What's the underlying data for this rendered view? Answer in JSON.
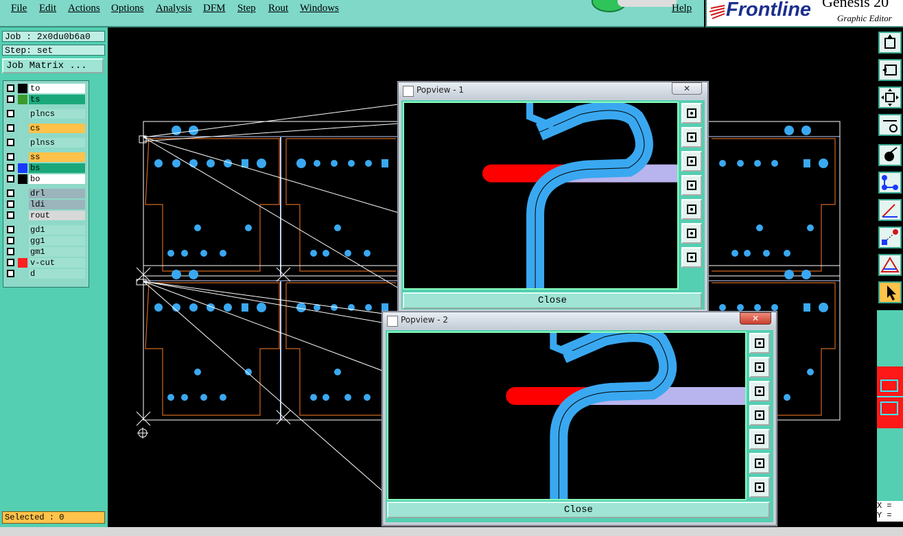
{
  "menu": [
    "File",
    "Edit",
    "Actions",
    "Options",
    "Analysis",
    "DFM",
    "Step",
    "Rout",
    "Windows"
  ],
  "help": "Help",
  "brand": {
    "logo": "Frontline",
    "product": "Genesis 20",
    "subtitle": "Graphic Editor"
  },
  "job": "Job : 2x0du0b6a0",
  "step": "Step: set",
  "job_matrix": "Job Matrix ...",
  "layers": [
    {
      "name": "to",
      "swatch": "#000000",
      "bg": "#ffffff"
    },
    {
      "name": "ts",
      "swatch": "#3a9a2a",
      "bg": "#1aa87a"
    },
    {
      "name": "plncs",
      "swatch": "",
      "bg": "#9fe0d0"
    },
    {
      "name": "cs",
      "swatch": "",
      "bg": "#ffc24a"
    },
    {
      "name": "plnss",
      "swatch": "",
      "bg": "#9fe0d0"
    },
    {
      "name": "ss",
      "swatch": "",
      "bg": "#ffc24a"
    },
    {
      "name": "bs",
      "swatch": "#1a3aff",
      "bg": "#1aa87a"
    },
    {
      "name": "bo",
      "swatch": "#000000",
      "bg": "#ffffff"
    },
    {
      "name": "drl",
      "swatch": "",
      "bg": "#9bb4bc"
    },
    {
      "name": "ldi",
      "swatch": "",
      "bg": "#9bb4bc"
    },
    {
      "name": "rout",
      "swatch": "",
      "bg": "#d8d8d8"
    },
    {
      "name": "gd1",
      "swatch": "",
      "bg": "#9fe0d0"
    },
    {
      "name": "gg1",
      "swatch": "",
      "bg": "#9fe0d0"
    },
    {
      "name": "gm1",
      "swatch": "",
      "bg": "#9fe0d0"
    },
    {
      "name": "v-cut",
      "swatch": "#ff2020",
      "bg": "#9fe0d0"
    },
    {
      "name": "d",
      "swatch": "",
      "bg": "#9fe0d0"
    }
  ],
  "selected": "Selected : 0",
  "popview1": {
    "title": "Popview - 1",
    "close": "Close"
  },
  "popview2": {
    "title": "Popview - 2",
    "close": "Close"
  },
  "coords": {
    "x": "X =",
    "y": "Y ="
  },
  "colors": {
    "accent": "#54cfb2",
    "pad": "#3aa8f0",
    "trace": "#ff0000",
    "trace2": "#b8b4ee"
  }
}
